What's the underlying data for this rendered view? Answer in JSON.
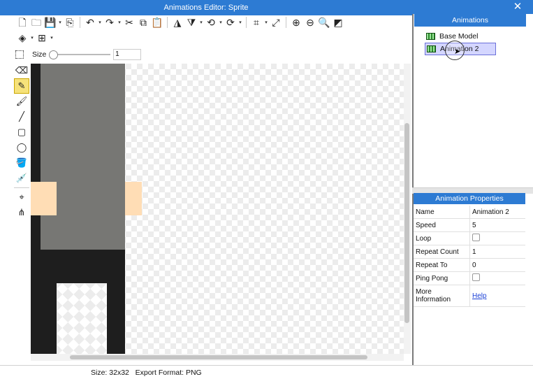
{
  "window": {
    "title": "Animations Editor: Sprite",
    "close_symbol": "✕"
  },
  "toolbar_row1": [
    {
      "name": "new-file-icon",
      "glyph": "🗋"
    },
    {
      "name": "open-folder-icon",
      "glyph": "🗀"
    },
    {
      "name": "save-icon",
      "glyph": "💾"
    },
    {
      "name": "export-icon",
      "glyph": "⎘"
    },
    {
      "name": "undo-icon",
      "glyph": "↶"
    },
    {
      "name": "redo-icon",
      "glyph": "↷"
    },
    {
      "name": "cut-icon",
      "glyph": "✂"
    },
    {
      "name": "copy-icon",
      "glyph": "⧉"
    },
    {
      "name": "paste-icon",
      "glyph": "📋"
    },
    {
      "name": "flip-horizontal-icon",
      "glyph": "◮"
    },
    {
      "name": "flip-vertical-icon",
      "glyph": "⧩"
    },
    {
      "name": "rotate-left-icon",
      "glyph": "⟲"
    },
    {
      "name": "rotate-right-icon",
      "glyph": "⟳"
    },
    {
      "name": "crop-icon",
      "glyph": "⌗"
    },
    {
      "name": "resize-icon",
      "glyph": "⤢"
    },
    {
      "name": "zoom-in-icon",
      "glyph": "⊕"
    },
    {
      "name": "zoom-out-icon",
      "glyph": "⊖"
    },
    {
      "name": "zoom-fit-icon",
      "glyph": "🔍"
    },
    {
      "name": "invert-icon",
      "glyph": "◩"
    }
  ],
  "toolbar_row2": [
    {
      "name": "layers-icon",
      "glyph": "◈"
    },
    {
      "name": "grid-icon",
      "glyph": "⊞"
    }
  ],
  "size_control": {
    "label": "Size",
    "value": "1",
    "slider_fraction": 0.0
  },
  "tools": [
    {
      "name": "eraser-icon",
      "glyph": "⌫"
    },
    {
      "name": "pencil-icon",
      "glyph": "✎",
      "active": true
    },
    {
      "name": "brush-icon",
      "glyph": "🖌"
    },
    {
      "name": "line-icon",
      "glyph": "╱"
    },
    {
      "name": "rectangle-icon",
      "glyph": "▢"
    },
    {
      "name": "ellipse-icon",
      "glyph": "◯"
    },
    {
      "name": "fill-bucket-icon",
      "glyph": "🪣"
    },
    {
      "name": "eyedropper-icon",
      "glyph": "💉"
    },
    {
      "name": "anchor-point-icon",
      "glyph": "⌖"
    },
    {
      "name": "skeleton-icon",
      "glyph": "⋔"
    }
  ],
  "status": {
    "text": "Size: 32x32   Export Format: PNG"
  },
  "animations_panel": {
    "title": "Animations",
    "items": [
      {
        "label": "Base Model",
        "selected": false
      },
      {
        "label": "Animation 2",
        "selected": true
      }
    ]
  },
  "properties_panel": {
    "title": "Animation Properties",
    "rows": [
      {
        "key": "Name",
        "value": "Animation 2",
        "type": "text"
      },
      {
        "key": "Speed",
        "value": "5",
        "type": "text"
      },
      {
        "key": "Loop",
        "value": "",
        "type": "checkbox",
        "checked": false
      },
      {
        "key": "Repeat Count",
        "value": "1",
        "type": "text"
      },
      {
        "key": "Repeat To",
        "value": "0",
        "type": "text"
      },
      {
        "key": "Ping Pong",
        "value": "",
        "type": "checkbox",
        "checked": false
      },
      {
        "key": "More Information",
        "value": "Help",
        "type": "link"
      }
    ]
  },
  "colors": {
    "accent": "#2d7bd3",
    "body_gray": "#777774",
    "dark": "#1e1e1e",
    "skin": "#ffddb5",
    "selection": "#d4d6ff"
  }
}
